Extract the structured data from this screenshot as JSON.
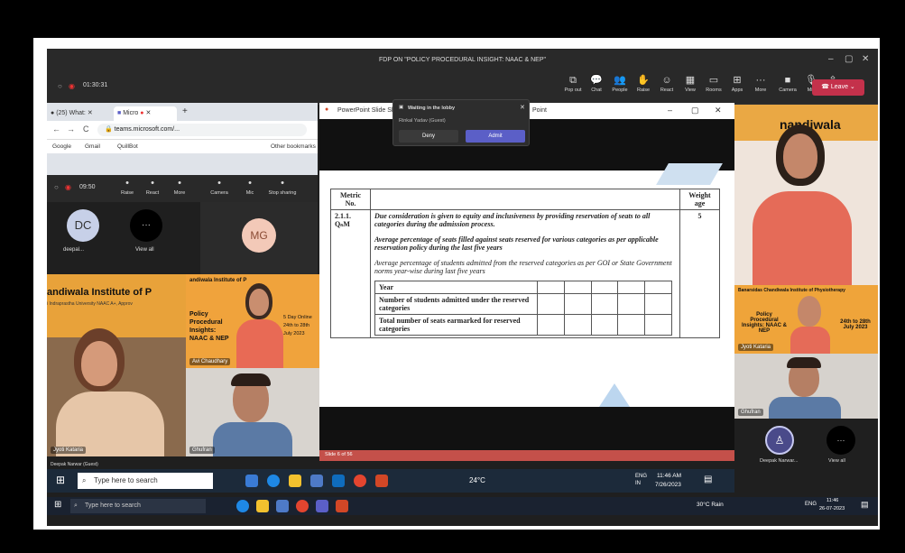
{
  "window": {
    "title": "FDP ON \"POLICY PROCEDURAL INSIGHT: NAAC & NEP\"",
    "controls": [
      "–",
      "▢",
      "✕"
    ]
  },
  "meeting": {
    "timer": "01:30:31",
    "leave": "Leave",
    "toolbar": [
      {
        "label": "Pop out",
        "icon": "popout-icon",
        "glyph": "⧉"
      },
      {
        "label": "Chat",
        "icon": "chat-icon",
        "glyph": "💬"
      },
      {
        "label": "People",
        "icon": "people-icon",
        "glyph": "👥"
      },
      {
        "label": "Raise",
        "icon": "hand-icon",
        "glyph": "✋"
      },
      {
        "label": "React",
        "icon": "smile-icon",
        "glyph": "☺"
      },
      {
        "label": "View",
        "icon": "grid-icon",
        "glyph": "▦"
      },
      {
        "label": "Rooms",
        "icon": "rooms-icon",
        "glyph": "▭"
      },
      {
        "label": "Apps",
        "icon": "apps-icon",
        "glyph": "⊞"
      },
      {
        "label": "More",
        "icon": "more-icon",
        "glyph": "···"
      },
      {
        "label": "Camera",
        "icon": "camera-icon",
        "glyph": "■"
      },
      {
        "label": "Mic",
        "icon": "mic-icon",
        "glyph": "🎙"
      },
      {
        "label": "Share",
        "icon": "share-icon",
        "glyph": "⇪"
      }
    ]
  },
  "browser": {
    "tabs": [
      "(25) What:",
      "Micro"
    ],
    "url": "teams.microsoft.com/...",
    "bookmarks": [
      "Google",
      "Gmail",
      "QuillBot",
      "Other bookmarks"
    ]
  },
  "inner_meeting": {
    "timer": "09:50",
    "buttons": [
      "Raise",
      "React",
      "More",
      "Camera",
      "Mic",
      "Stop sharing"
    ],
    "participants": [
      {
        "initials": "DC",
        "name": "deepal..."
      },
      {
        "initials": "···",
        "name": "View all"
      },
      {
        "initials": "MG",
        "name": ""
      }
    ],
    "tiles": [
      "Jyoti Kataria",
      "Avi Chaudhary",
      "Ghufran"
    ]
  },
  "banner": {
    "line1": "andiwala Institute of P",
    "line2": "i Indraprastha University NAAC A+, Approv",
    "line3": "Policy",
    "line4": "Procedural",
    "line5": "Insights:",
    "line6": "NAAC & NEP",
    "line7": "5 Day Online",
    "line8": "24th to 28th",
    "line9": "July 2023",
    "title_right": "Banarsidas Chandiwala Institute of Physiotherapy"
  },
  "ppt": {
    "window_title": "PowerPoint Slide Sh",
    "window_title2": "Point",
    "status": "Slide 6 of 56"
  },
  "lobby": {
    "title": "Waiting in the lobby",
    "guest": "Rinkal Yadav (Guest)",
    "deny": "Deny",
    "admit": "Admit"
  },
  "slide": {
    "head": [
      "Metric No.",
      "",
      "Weight age"
    ],
    "metric": "2.1.1. QₙM",
    "weight": "5",
    "p1": "Due consideration is given to equity and inclusiveness by providing reservation of seats to all categories during the admission process.",
    "p2": "Average percentage of seats filled against seats reserved for various categories as per applicable reservation policy during the last five years",
    "p3": "Average percentage of students admitted from the reserved categories as per GOI or State Government norms year-wise during last five years",
    "rows": [
      "Year",
      "Number of students admitted under the reserved categories",
      "Total number of seats earmarked for reserved categories"
    ]
  },
  "right_tiles": [
    "nandiwala",
    "Banarsidas Chandiwala Institute of Physiotherapy",
    "Policy Procedural Insights: NAAC & NEP",
    "24th to 28th July 2023",
    "Jyoti Kataria",
    "Ghufran"
  ],
  "right_bottom": {
    "name": "Deepak Narwar...",
    "viewall": "View all"
  },
  "taskbar_inner": {
    "search": "Type here to search",
    "user": "Deepak Narwar (Guest)",
    "weather": "24°C",
    "lang": "ENG\nIN",
    "time": "11:46 AM",
    "date": "7/26/2023"
  },
  "taskbar_outer": {
    "search": "Type here to search",
    "weather": "30°C Rain",
    "lang": "ENG",
    "time": "11:46",
    "date": "26-07-2023"
  }
}
